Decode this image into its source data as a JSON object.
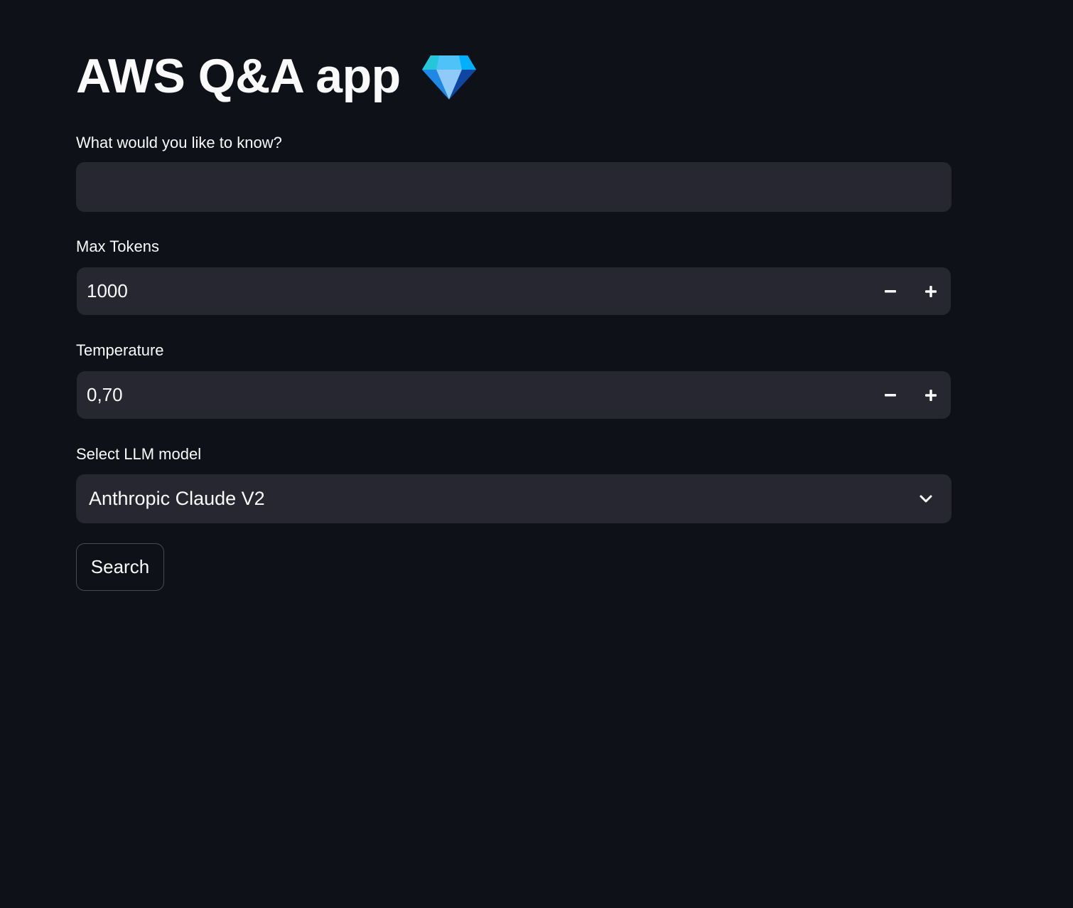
{
  "app": {
    "title": "AWS Q&A app",
    "title_icon": "gem-icon"
  },
  "question": {
    "label": "What would you like to know?",
    "value": "",
    "placeholder": ""
  },
  "max_tokens": {
    "label": "Max Tokens",
    "value": "1000",
    "decrement_icon": "minus-icon",
    "increment_icon": "plus-icon"
  },
  "temperature": {
    "label": "Temperature",
    "value": "0,70",
    "decrement_icon": "minus-icon",
    "increment_icon": "plus-icon"
  },
  "model": {
    "label": "Select LLM model",
    "selected": "Anthropic Claude V2",
    "icon": "chevron-down-icon"
  },
  "search": {
    "label": "Search"
  },
  "colors": {
    "background": "#0e1117",
    "input_background": "#262730",
    "text": "#fafafa"
  }
}
